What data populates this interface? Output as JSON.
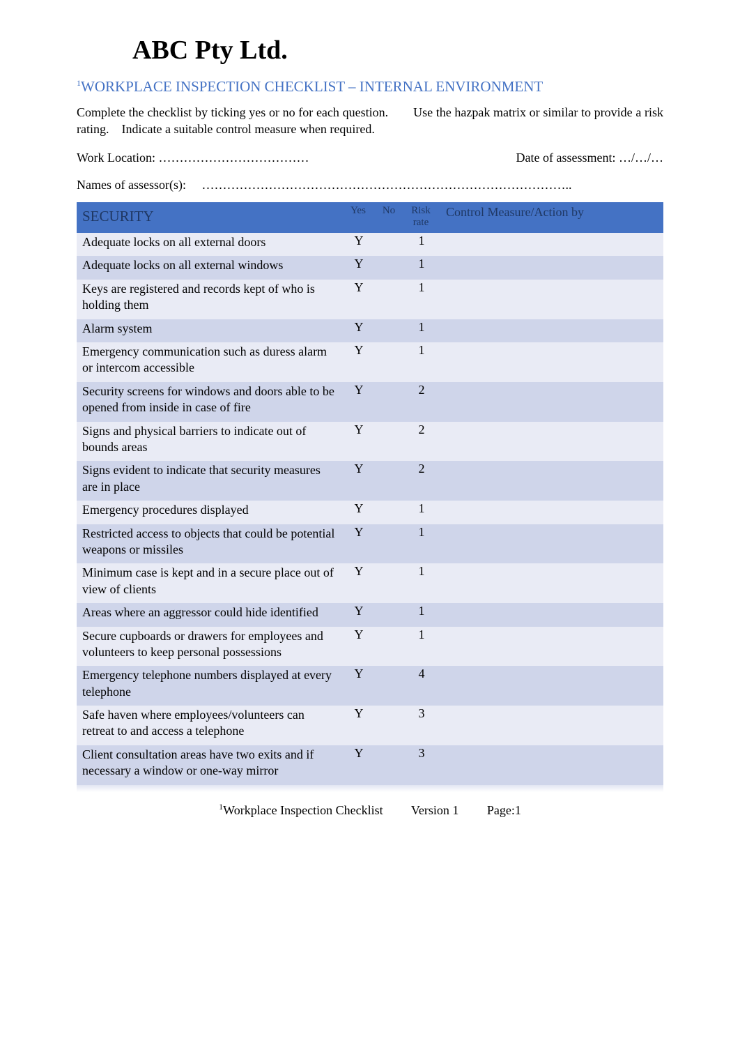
{
  "company": "ABC Pty Ltd.",
  "superscript1": "1",
  "section_title": "WORKPLACE INSPECTION CHECKLIST – INTERNAL ENVIRONMENT",
  "intro": "Complete the checklist by ticking yes or no for each question.  Use the hazpak matrix or similar to provide a risk rating. Indicate a suitable control measure when required.",
  "work_location_label": "Work Location: ………………………………",
  "date_label": "Date of assessment: …/…/…",
  "assessors_label": "Names of assessor(s):  ……………………………………………………………………………..",
  "headers": {
    "category": "SECURITY",
    "yes": "Yes",
    "no": "No",
    "rate_l1": "Risk",
    "rate_l2": "rate",
    "control": "Control Measure/Action by"
  },
  "rows": [
    {
      "q": "Adequate locks on all external doors",
      "yes": "Y",
      "no": "",
      "rate": "1",
      "ctrl": ""
    },
    {
      "q": "Adequate locks on all external windows",
      "yes": "Y",
      "no": "",
      "rate": "1",
      "ctrl": ""
    },
    {
      "q": "Keys are registered and records kept of who is holding them",
      "yes": "Y",
      "no": "",
      "rate": "1",
      "ctrl": ""
    },
    {
      "q": "Alarm system",
      "yes": "Y",
      "no": "",
      "rate": "1",
      "ctrl": ""
    },
    {
      "q": "Emergency communication such as duress alarm or intercom accessible",
      "yes": "Y",
      "no": "",
      "rate": "1",
      "ctrl": ""
    },
    {
      "q": "Security screens for windows and doors able to be opened from inside in case of fire",
      "yes": "Y",
      "no": "",
      "rate": "2",
      "ctrl": ""
    },
    {
      "q": "Signs and physical barriers to indicate out of bounds areas",
      "yes": "Y",
      "no": "",
      "rate": "2",
      "ctrl": ""
    },
    {
      "q": "Signs evident to indicate that security measures are in place",
      "yes": "Y",
      "no": "",
      "rate": "2",
      "ctrl": ""
    },
    {
      "q": "Emergency procedures displayed",
      "yes": "Y",
      "no": "",
      "rate": "1",
      "ctrl": ""
    },
    {
      "q": "Restricted access to objects that could be potential weapons or missiles",
      "yes": "Y",
      "no": "",
      "rate": "1",
      "ctrl": ""
    },
    {
      "q": "Minimum case is kept and in a secure place out of view of clients",
      "yes": "Y",
      "no": "",
      "rate": "1",
      "ctrl": ""
    },
    {
      "q": "Areas where an aggressor could hide identified",
      "yes": "Y",
      "no": "",
      "rate": "1",
      "ctrl": ""
    },
    {
      "q": "Secure cupboards or drawers for employees and volunteers to keep personal possessions",
      "yes": "Y",
      "no": "",
      "rate": "1",
      "ctrl": ""
    },
    {
      "q": "Emergency telephone numbers displayed at every telephone",
      "yes": "Y",
      "no": "",
      "rate": "4",
      "ctrl": ""
    },
    {
      "q": "Safe haven where employees/volunteers can retreat to and access a telephone",
      "yes": "Y",
      "no": "",
      "rate": "3",
      "ctrl": ""
    },
    {
      "q": "Client consultation areas have two exits and if necessary a window or one-way mirror",
      "yes": "Y",
      "no": "",
      "rate": "3",
      "ctrl": ""
    }
  ],
  "footer": {
    "sup": "1",
    "doc": "Workplace Inspection Checklist",
    "version": "Version 1",
    "page": "Page:1"
  }
}
